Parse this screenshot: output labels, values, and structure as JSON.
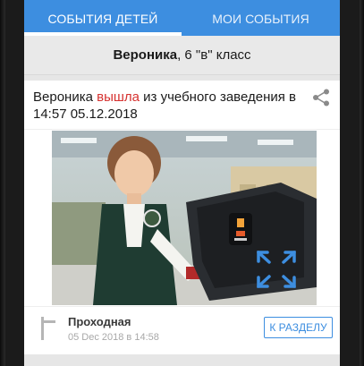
{
  "tabs": {
    "children_events": "События детей",
    "my_events": "Мои события"
  },
  "student": {
    "name": "Вероника",
    "class_label": ", 6 \"в\" класс"
  },
  "event": {
    "subject": "Вероника",
    "action": "вышла",
    "rest": "из учебного заведения в 14:57 05.12.2018",
    "source_name": "Проходная",
    "source_time": "05 Dec 2018 в 14:58",
    "section_button": "К разделу"
  },
  "icons": {
    "share": "share-icon",
    "expand": "expand-icon",
    "source": "turnstile-icon"
  },
  "colors": {
    "accent": "#3d8ee0",
    "action_red": "#d6312f"
  }
}
